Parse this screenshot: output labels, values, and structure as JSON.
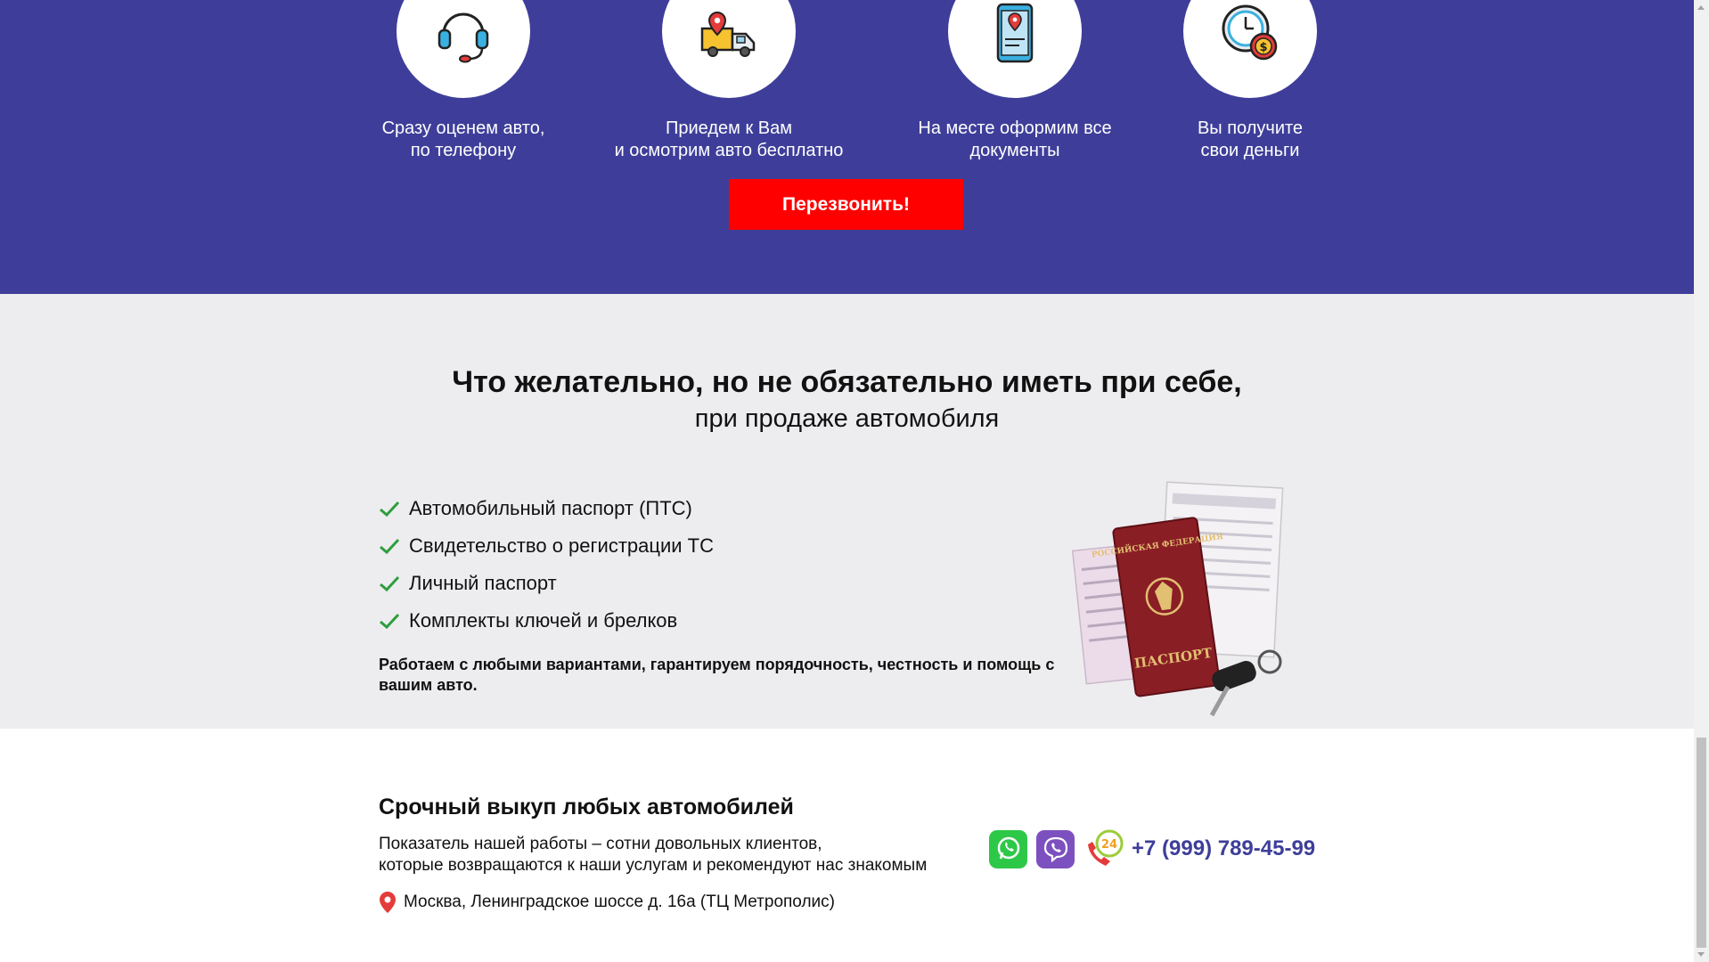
{
  "steps": [
    {
      "icon": "headset-icon",
      "caption": "Сразу оценем авто,\nпо телефону"
    },
    {
      "icon": "truck-location-icon",
      "caption": "Приедем к Вам\nи осмотрим авто бесплатно"
    },
    {
      "icon": "smartphone-location-icon",
      "caption": "На месте оформим все\nдокументы"
    },
    {
      "icon": "clock-money-icon",
      "caption": "Вы получите\nсвои деньги"
    }
  ],
  "cta": {
    "label": "Перезвонить!"
  },
  "docs": {
    "title": "Что желательно, но не обязательно иметь при себе,",
    "subtitle": "при продаже автомобиля",
    "items": [
      "Автомобильный паспорт (ПТС)",
      "Свидетельство о регистрации ТС",
      "Личный паспорт",
      "Комплекты ключей и брелков"
    ],
    "note": "Работаем с любыми вариантами, гарантируем порядочность, честность и помощь с вашим авто.",
    "passport_text": "ПАСПОРТ",
    "passport_header": "РОССИЙСКАЯ ФЕДЕРАЦИЯ"
  },
  "footer": {
    "title": "Срочный выкуп любых автомобилей",
    "desc_line1": "Показатель нашей работы – сотни довольных клиентов,",
    "desc_line2": "которые возвращаются к наши услугам и рекомендуют нас знакомым",
    "address": "Москва, Ленинградское шоссе д. 16а (ТЦ Метрополис)",
    "phone": "+7 (999) 789-45-99",
    "badge_24": "24"
  },
  "colors": {
    "hero_bg": "#3e3e9a",
    "cta_bg": "#ff0000",
    "docs_bg": "#ededf0",
    "check": "#2e9e3e",
    "phone": "#3e3e9a"
  }
}
